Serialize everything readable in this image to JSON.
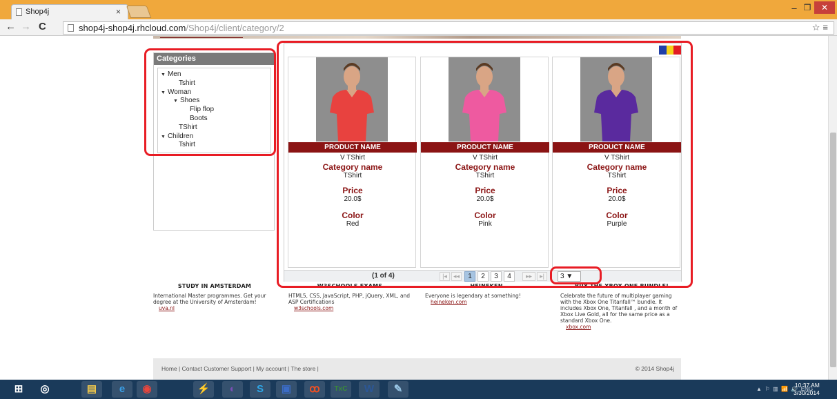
{
  "browser": {
    "tab_title": "Shop4j",
    "tab_close": "×",
    "url_host": "shop4j-shop4j.rhcloud.com",
    "url_path": "/Shop4j/client/category/2",
    "back": "←",
    "forward": "→",
    "reload": "C",
    "tools": "☆≡"
  },
  "categories": {
    "title": "Categories",
    "tree": [
      {
        "label": "Men",
        "level": 0,
        "expanded": true
      },
      {
        "label": "Tshirt",
        "level": 1
      },
      {
        "label": "Woman",
        "level": 0,
        "expanded": true
      },
      {
        "label": "Shoes",
        "level": 1,
        "expanded": true
      },
      {
        "label": "Flip flop",
        "level": 2
      },
      {
        "label": "Boots",
        "level": 2
      },
      {
        "label": "TShirt",
        "level": 1
      },
      {
        "label": "Children",
        "level": 0,
        "expanded": true
      },
      {
        "label": "Tshirt",
        "level": 1
      }
    ]
  },
  "flag_colors": [
    "#1f3fa8",
    "#f5d21a",
    "#e21b23"
  ],
  "products": [
    {
      "name_label": "PRODUCT NAME",
      "name": "V TShirt",
      "category_label": "Category name",
      "category": "TShirt",
      "price_label": "Price",
      "price": "20.0$",
      "color_label": "Color",
      "color": "Red",
      "shirt_hex": "#e8423f"
    },
    {
      "name_label": "PRODUCT NAME",
      "name": "V TShirt",
      "category_label": "Category name",
      "category": "TShirt",
      "price_label": "Price",
      "price": "20.0$",
      "color_label": "Color",
      "color": "Pink",
      "shirt_hex": "#ee5aa0"
    },
    {
      "name_label": "PRODUCT NAME",
      "name": "V TShirt",
      "category_label": "Category name",
      "category": "TShirt",
      "price_label": "Price",
      "price": "20.0$",
      "color_label": "Color",
      "color": "Purple",
      "shirt_hex": "#5a2a9e"
    }
  ],
  "paginator": {
    "info": "(1 of 4)",
    "first": "|◂",
    "prev": "◂◂",
    "pages": [
      "1",
      "2",
      "3",
      "4"
    ],
    "current_page": 1,
    "next": "▸▸",
    "last": "▸|",
    "rows_per_page": "3 ▼"
  },
  "footer": [
    {
      "title": "STUDY IN AMSTERDAM",
      "text": "International Master programmes. Get your degree at the University of Amsterdam!",
      "link": "uva.nl"
    },
    {
      "title": "W3SCHOOLS EXAMS",
      "text": "HTML5, CSS, JavaScript, PHP, jQuery, XML, and ASP Certifications",
      "link": "w3schools.com"
    },
    {
      "title": "HEINEKEN",
      "text": "Everyone is legendary at something!",
      "link": "heineken.com"
    },
    {
      "title": "BUY THE XBOX ONE BUNDLE!",
      "text": "Celebrate the future of multiplayer gaming with the Xbox One Titanfall™ bundle. It includes Xbox One, Titanfall , and a month of Xbox Live Gold, all for the same price as a standard Xbox One.",
      "link": "xbox.com"
    }
  ],
  "bottom_bar": {
    "links": "Home | Contact Customer Support | My account | The store |",
    "copyright": "© 2014 Shop4j"
  },
  "taskbar": {
    "icons": [
      {
        "name": "start-icon",
        "glyph": "⊞",
        "color": "#ffffff"
      },
      {
        "name": "search-icon",
        "glyph": "◎",
        "color": "#ffffff"
      },
      {
        "name": "file-explorer-icon",
        "glyph": "▤",
        "color": "#f2c94c"
      },
      {
        "name": "internet-explorer-icon",
        "glyph": "e",
        "color": "#3aa0e8"
      },
      {
        "name": "chrome-icon",
        "glyph": "◉",
        "color": "#e8453c"
      },
      {
        "name": "network-tool-icon",
        "glyph": "⚡",
        "color": "#7fb1e0"
      },
      {
        "name": "eclipse-icon",
        "glyph": "◐",
        "color": "#7a4fb5"
      },
      {
        "name": "skype-icon",
        "glyph": "S",
        "color": "#2ea7e8"
      },
      {
        "name": "save-app-icon",
        "glyph": "▣",
        "color": "#3b6cc6"
      },
      {
        "name": "xampp-icon",
        "glyph": "ꝏ",
        "color": "#f25022"
      },
      {
        "name": "texmaker-icon",
        "glyph": "TxC",
        "color": "#3a8a3a"
      },
      {
        "name": "word-icon",
        "glyph": "W",
        "color": "#2b5797"
      },
      {
        "name": "paint-icon",
        "glyph": "✎",
        "color": "#9ac7e6"
      }
    ],
    "language": "ENG",
    "time": "10:37 AM",
    "date": "3/30/2014"
  }
}
